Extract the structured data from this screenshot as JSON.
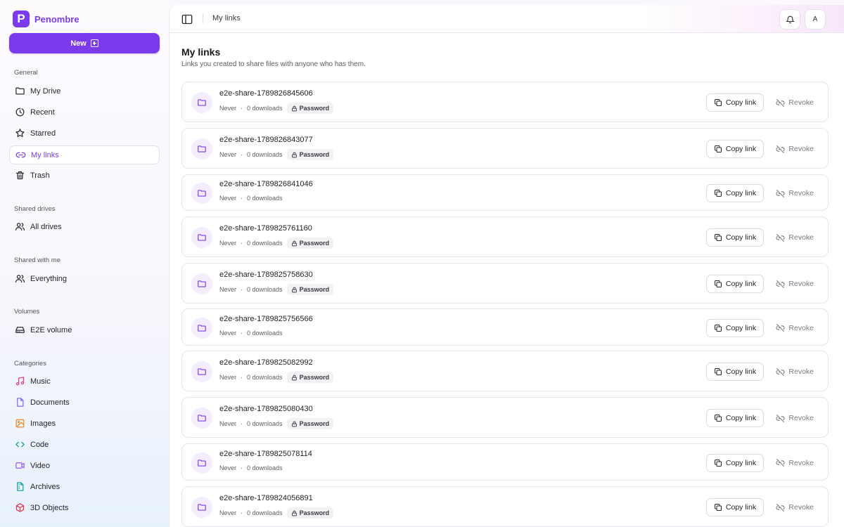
{
  "app": {
    "name": "Penombre",
    "logo_letter": "P",
    "accent": "#7c3aed"
  },
  "sidebar": {
    "new_label": "New",
    "sections": {
      "general": "General",
      "shared_drives": "Shared drives",
      "shared_with_me": "Shared with me",
      "volumes": "Volumes",
      "categories": "Categories"
    },
    "items": {
      "my_drive": "My Drive",
      "recent": "Recent",
      "starred": "Starred",
      "my_links": "My links",
      "trash": "Trash",
      "all_drives": "All drives",
      "everything": "Everything",
      "e2e_volume": "E2E volume",
      "music": "Music",
      "documents": "Documents",
      "images": "Images",
      "code": "Code",
      "video": "Video",
      "archives": "Archives",
      "objects_3d": "3D Objects"
    },
    "category_colors": {
      "music": "#e23e8c",
      "documents": "#7c6df0",
      "images": "#f08a24",
      "code": "#16a37f",
      "video": "#9d5cf0",
      "archives": "#16a3a3",
      "objects_3d": "#e8324f"
    }
  },
  "topbar": {
    "breadcrumb": "My links",
    "avatar_letter": "A"
  },
  "page": {
    "title": "My links",
    "subtitle": "Links you created to share files with anyone who has them."
  },
  "links": [
    {
      "name": "e2e-share-1789826845606",
      "expires": "Never",
      "downloads": "0 downloads",
      "password": "Password"
    },
    {
      "name": "e2e-share-1789826843077",
      "expires": "Never",
      "downloads": "0 downloads",
      "password": "Password"
    },
    {
      "name": "e2e-share-1789826841046",
      "expires": "Never",
      "downloads": "0 downloads",
      "password": ""
    },
    {
      "name": "e2e-share-1789825761160",
      "expires": "Never",
      "downloads": "0 downloads",
      "password": "Password"
    },
    {
      "name": "e2e-share-1789825758630",
      "expires": "Never",
      "downloads": "0 downloads",
      "password": "Password"
    },
    {
      "name": "e2e-share-1789825756566",
      "expires": "Never",
      "downloads": "0 downloads",
      "password": ""
    },
    {
      "name": "e2e-share-1789825082992",
      "expires": "Never",
      "downloads": "0 downloads",
      "password": "Password"
    },
    {
      "name": "e2e-share-1789825080430",
      "expires": "Never",
      "downloads": "0 downloads",
      "password": "Password"
    },
    {
      "name": "e2e-share-1789825078114",
      "expires": "Never",
      "downloads": "0 downloads",
      "password": ""
    },
    {
      "name": "e2e-share-1789824056891",
      "expires": "Never",
      "downloads": "0 downloads",
      "password": "Password"
    }
  ],
  "actions": {
    "copy_label": "Copy link",
    "revoke_label": "Revoke"
  }
}
